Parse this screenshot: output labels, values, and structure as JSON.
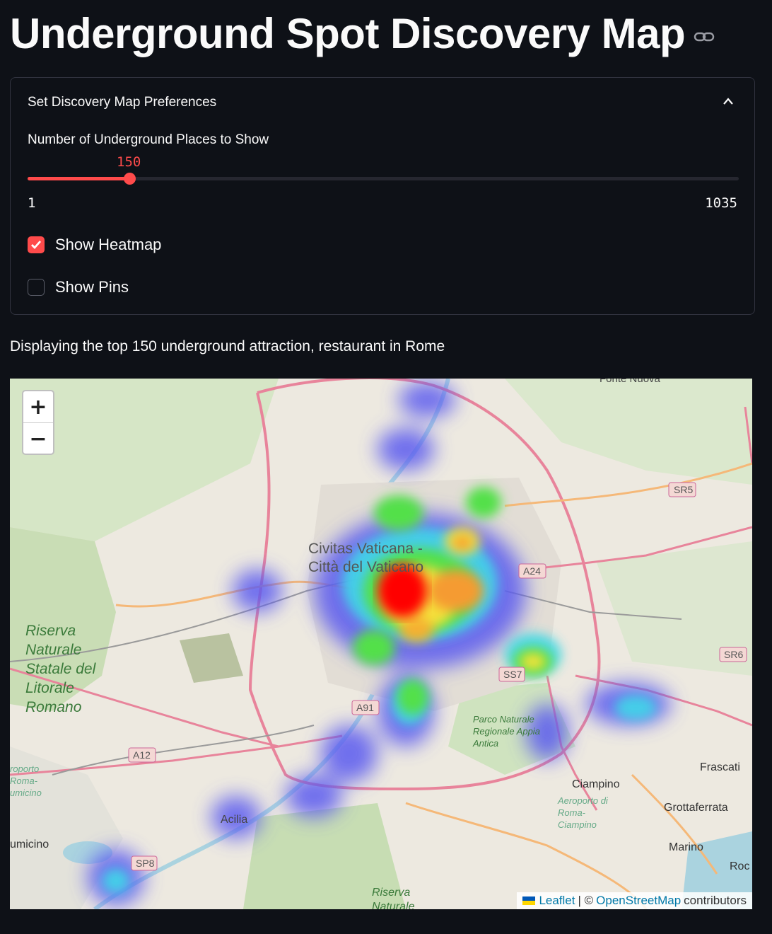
{
  "page": {
    "title": "Underground Spot Discovery Map",
    "caption": "Displaying the top 150 underground attraction, restaurant in Rome"
  },
  "preferences": {
    "header": "Set Discovery Map Preferences",
    "slider": {
      "label": "Number of Underground Places to Show",
      "value": "150",
      "min": "1",
      "max": "1035",
      "fraction": 0.144
    },
    "heatmap": {
      "label": "Show Heatmap",
      "checked": true
    },
    "pins": {
      "label": "Show Pins",
      "checked": false
    }
  },
  "map": {
    "zoom_in": "+",
    "zoom_out": "−",
    "attribution": {
      "leaflet": "Leaflet",
      "separator": "| ©",
      "osm": "OpenStreetMap",
      "suffix": "contributors"
    },
    "places": {
      "vatican": "Civitas Vaticana - Città del Vaticano",
      "riserva": "Riserva Naturale Statale del Litorale Romano",
      "acilia": "Acilia",
      "ciampino": "Ciampino",
      "airport_ciampino": "Aeroporto di Roma-Ciampino",
      "grottaferrata": "Grottaferrata",
      "frascati": "Frascati",
      "marino": "Marino",
      "parco": "Parco Naturale Regionale Appia Antica",
      "fonte": "Fonte Nuova",
      "fiumicino": "umicino",
      "airport_fiumicino": "roporto Roma-umicino",
      "riserva2": "Riserva Naturale",
      "rocca": "Roc"
    },
    "road_shields": [
      "SR5",
      "A24",
      "SR6",
      "A12",
      "A91",
      "SS7",
      "SP8"
    ],
    "accent_color": "#ff4b4b"
  }
}
